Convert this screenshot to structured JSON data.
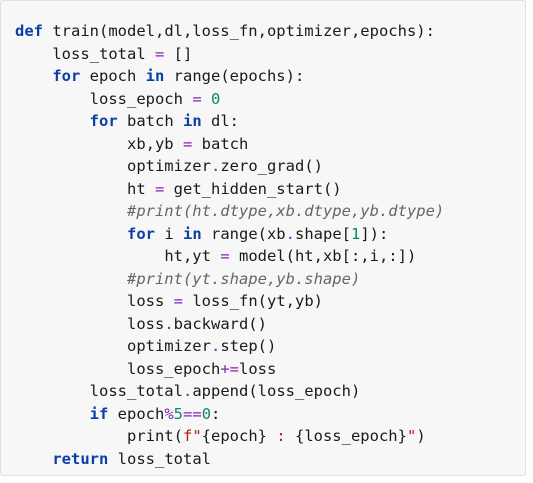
{
  "code_block": {
    "language": "python",
    "lines": [
      {
        "indent": 0,
        "tokens": [
          {
            "t": "def",
            "k": "kw"
          },
          {
            "t": " train(model,dl,loss_fn,optimizer,epochs):",
            "k": "txt"
          }
        ]
      },
      {
        "indent": 1,
        "tokens": [
          {
            "t": "loss_total ",
            "k": "txt"
          },
          {
            "t": "=",
            "k": "op"
          },
          {
            "t": " []",
            "k": "txt"
          }
        ]
      },
      {
        "indent": 1,
        "tokens": [
          {
            "t": "for",
            "k": "kw"
          },
          {
            "t": " epoch ",
            "k": "txt"
          },
          {
            "t": "in",
            "k": "kw"
          },
          {
            "t": " range(epochs):",
            "k": "txt"
          }
        ]
      },
      {
        "indent": 2,
        "tokens": [
          {
            "t": "loss_epoch ",
            "k": "txt"
          },
          {
            "t": "=",
            "k": "op"
          },
          {
            "t": " ",
            "k": "txt"
          },
          {
            "t": "0",
            "k": "num"
          }
        ]
      },
      {
        "indent": 2,
        "tokens": [
          {
            "t": "for",
            "k": "kw"
          },
          {
            "t": " batch ",
            "k": "txt"
          },
          {
            "t": "in",
            "k": "kw"
          },
          {
            "t": " dl:",
            "k": "txt"
          }
        ]
      },
      {
        "indent": 3,
        "tokens": [
          {
            "t": "xb,yb ",
            "k": "txt"
          },
          {
            "t": "=",
            "k": "op"
          },
          {
            "t": " batch",
            "k": "txt"
          }
        ]
      },
      {
        "indent": 3,
        "tokens": [
          {
            "t": "optimizer",
            "k": "txt"
          },
          {
            "t": ".",
            "k": "op"
          },
          {
            "t": "zero_grad()",
            "k": "txt"
          }
        ]
      },
      {
        "indent": 3,
        "tokens": [
          {
            "t": "ht ",
            "k": "txt"
          },
          {
            "t": "=",
            "k": "op"
          },
          {
            "t": " get_hidden_start()",
            "k": "txt"
          }
        ]
      },
      {
        "indent": 3,
        "tokens": [
          {
            "t": "#print(ht.dtype,xb.dtype,yb.dtype)",
            "k": "cmt"
          }
        ]
      },
      {
        "indent": 3,
        "tokens": [
          {
            "t": "for",
            "k": "kw"
          },
          {
            "t": " i ",
            "k": "txt"
          },
          {
            "t": "in",
            "k": "kw"
          },
          {
            "t": " range(xb",
            "k": "txt"
          },
          {
            "t": ".",
            "k": "op"
          },
          {
            "t": "shape[",
            "k": "txt"
          },
          {
            "t": "1",
            "k": "num"
          },
          {
            "t": "]):",
            "k": "txt"
          }
        ]
      },
      {
        "indent": 4,
        "tokens": [
          {
            "t": "ht,yt ",
            "k": "txt"
          },
          {
            "t": "=",
            "k": "op"
          },
          {
            "t": " model(ht,xb[:,i,:])",
            "k": "txt"
          }
        ]
      },
      {
        "indent": 3,
        "tokens": [
          {
            "t": "#print(yt.shape,yb.shape)",
            "k": "cmt"
          }
        ]
      },
      {
        "indent": 3,
        "tokens": [
          {
            "t": "loss ",
            "k": "txt"
          },
          {
            "t": "=",
            "k": "op"
          },
          {
            "t": " loss_fn(yt,yb)",
            "k": "txt"
          }
        ]
      },
      {
        "indent": 3,
        "tokens": [
          {
            "t": "loss",
            "k": "txt"
          },
          {
            "t": ".",
            "k": "op"
          },
          {
            "t": "backward()",
            "k": "txt"
          }
        ]
      },
      {
        "indent": 3,
        "tokens": [
          {
            "t": "optimizer",
            "k": "txt"
          },
          {
            "t": ".",
            "k": "op"
          },
          {
            "t": "step()",
            "k": "txt"
          }
        ]
      },
      {
        "indent": 3,
        "tokens": [
          {
            "t": "loss_epoch",
            "k": "txt"
          },
          {
            "t": "+=",
            "k": "op"
          },
          {
            "t": "loss",
            "k": "txt"
          }
        ]
      },
      {
        "indent": 2,
        "tokens": [
          {
            "t": "loss_total",
            "k": "txt"
          },
          {
            "t": ".",
            "k": "op"
          },
          {
            "t": "append(loss_epoch)",
            "k": "txt"
          }
        ]
      },
      {
        "indent": 2,
        "tokens": [
          {
            "t": "if",
            "k": "kw"
          },
          {
            "t": " epoch",
            "k": "txt"
          },
          {
            "t": "%",
            "k": "op"
          },
          {
            "t": "5",
            "k": "num"
          },
          {
            "t": "==",
            "k": "op"
          },
          {
            "t": "0",
            "k": "num"
          },
          {
            "t": ":",
            "k": "txt"
          }
        ]
      },
      {
        "indent": 3,
        "tokens": [
          {
            "t": "print(",
            "k": "txt"
          },
          {
            "t": "f\"",
            "k": "str"
          },
          {
            "t": "{epoch}",
            "k": "txt"
          },
          {
            "t": " : ",
            "k": "str"
          },
          {
            "t": "{loss_epoch}",
            "k": "txt"
          },
          {
            "t": "\"",
            "k": "str"
          },
          {
            "t": ")",
            "k": "txt"
          }
        ]
      },
      {
        "indent": 1,
        "tokens": [
          {
            "t": "return",
            "k": "kw"
          },
          {
            "t": " loss_total",
            "k": "txt"
          }
        ]
      }
    ],
    "colors": {
      "background": "#f7f7f7",
      "keyword": "#0b3ea8",
      "operator": "#8a1fb5",
      "number": "#0a8a5a",
      "string": "#b11b1b",
      "comment": "#666666",
      "text": "#1a1a1a"
    }
  }
}
